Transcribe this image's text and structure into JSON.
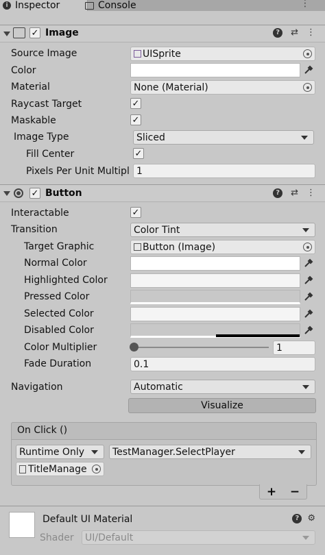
{
  "tabs": [
    {
      "label": "Inspector",
      "icon": "info-icon"
    },
    {
      "label": "Console",
      "icon": "console-icon"
    }
  ],
  "image_component": {
    "title": "Image",
    "source_image_label": "Source Image",
    "source_image_value": "UISprite",
    "color_label": "Color",
    "material_label": "Material",
    "material_value": "None (Material)",
    "raycast_label": "Raycast Target",
    "maskable_label": "Maskable",
    "image_type_label": "Image Type",
    "image_type_value": "Sliced",
    "fill_center_label": "Fill Center",
    "ppu_label": "Pixels Per Unit Multipl",
    "ppu_value": "1"
  },
  "button_component": {
    "title": "Button",
    "interactable_label": "Interactable",
    "transition_label": "Transition",
    "transition_value": "Color Tint",
    "target_graphic_label": "Target Graphic",
    "target_graphic_value": "Button (Image)",
    "normal_color_label": "Normal Color",
    "highlighted_color_label": "Highlighted Color",
    "pressed_color_label": "Pressed Color",
    "selected_color_label": "Selected Color",
    "disabled_color_label": "Disabled Color",
    "color_multiplier_label": "Color Multiplier",
    "color_multiplier_value": "1",
    "fade_duration_label": "Fade Duration",
    "fade_duration_value": "0.1",
    "navigation_label": "Navigation",
    "navigation_value": "Automatic",
    "visualize_label": "Visualize",
    "onclick_title": "On Click ()",
    "runtime_value": "Runtime Only",
    "function_value": "TestManager.SelectPlayer",
    "object_value": "TitleManage",
    "add_label": "+",
    "remove_label": "−"
  },
  "material_section": {
    "name": "Default UI Material",
    "shader_label": "Shader",
    "shader_value": "UI/Default"
  },
  "colors": {
    "normal": "#ffffff",
    "highlighted": "#f5f5f5",
    "pressed": "#c8c8c8",
    "selected": "#f5f5f5",
    "disabled": "#c8c8c8"
  }
}
